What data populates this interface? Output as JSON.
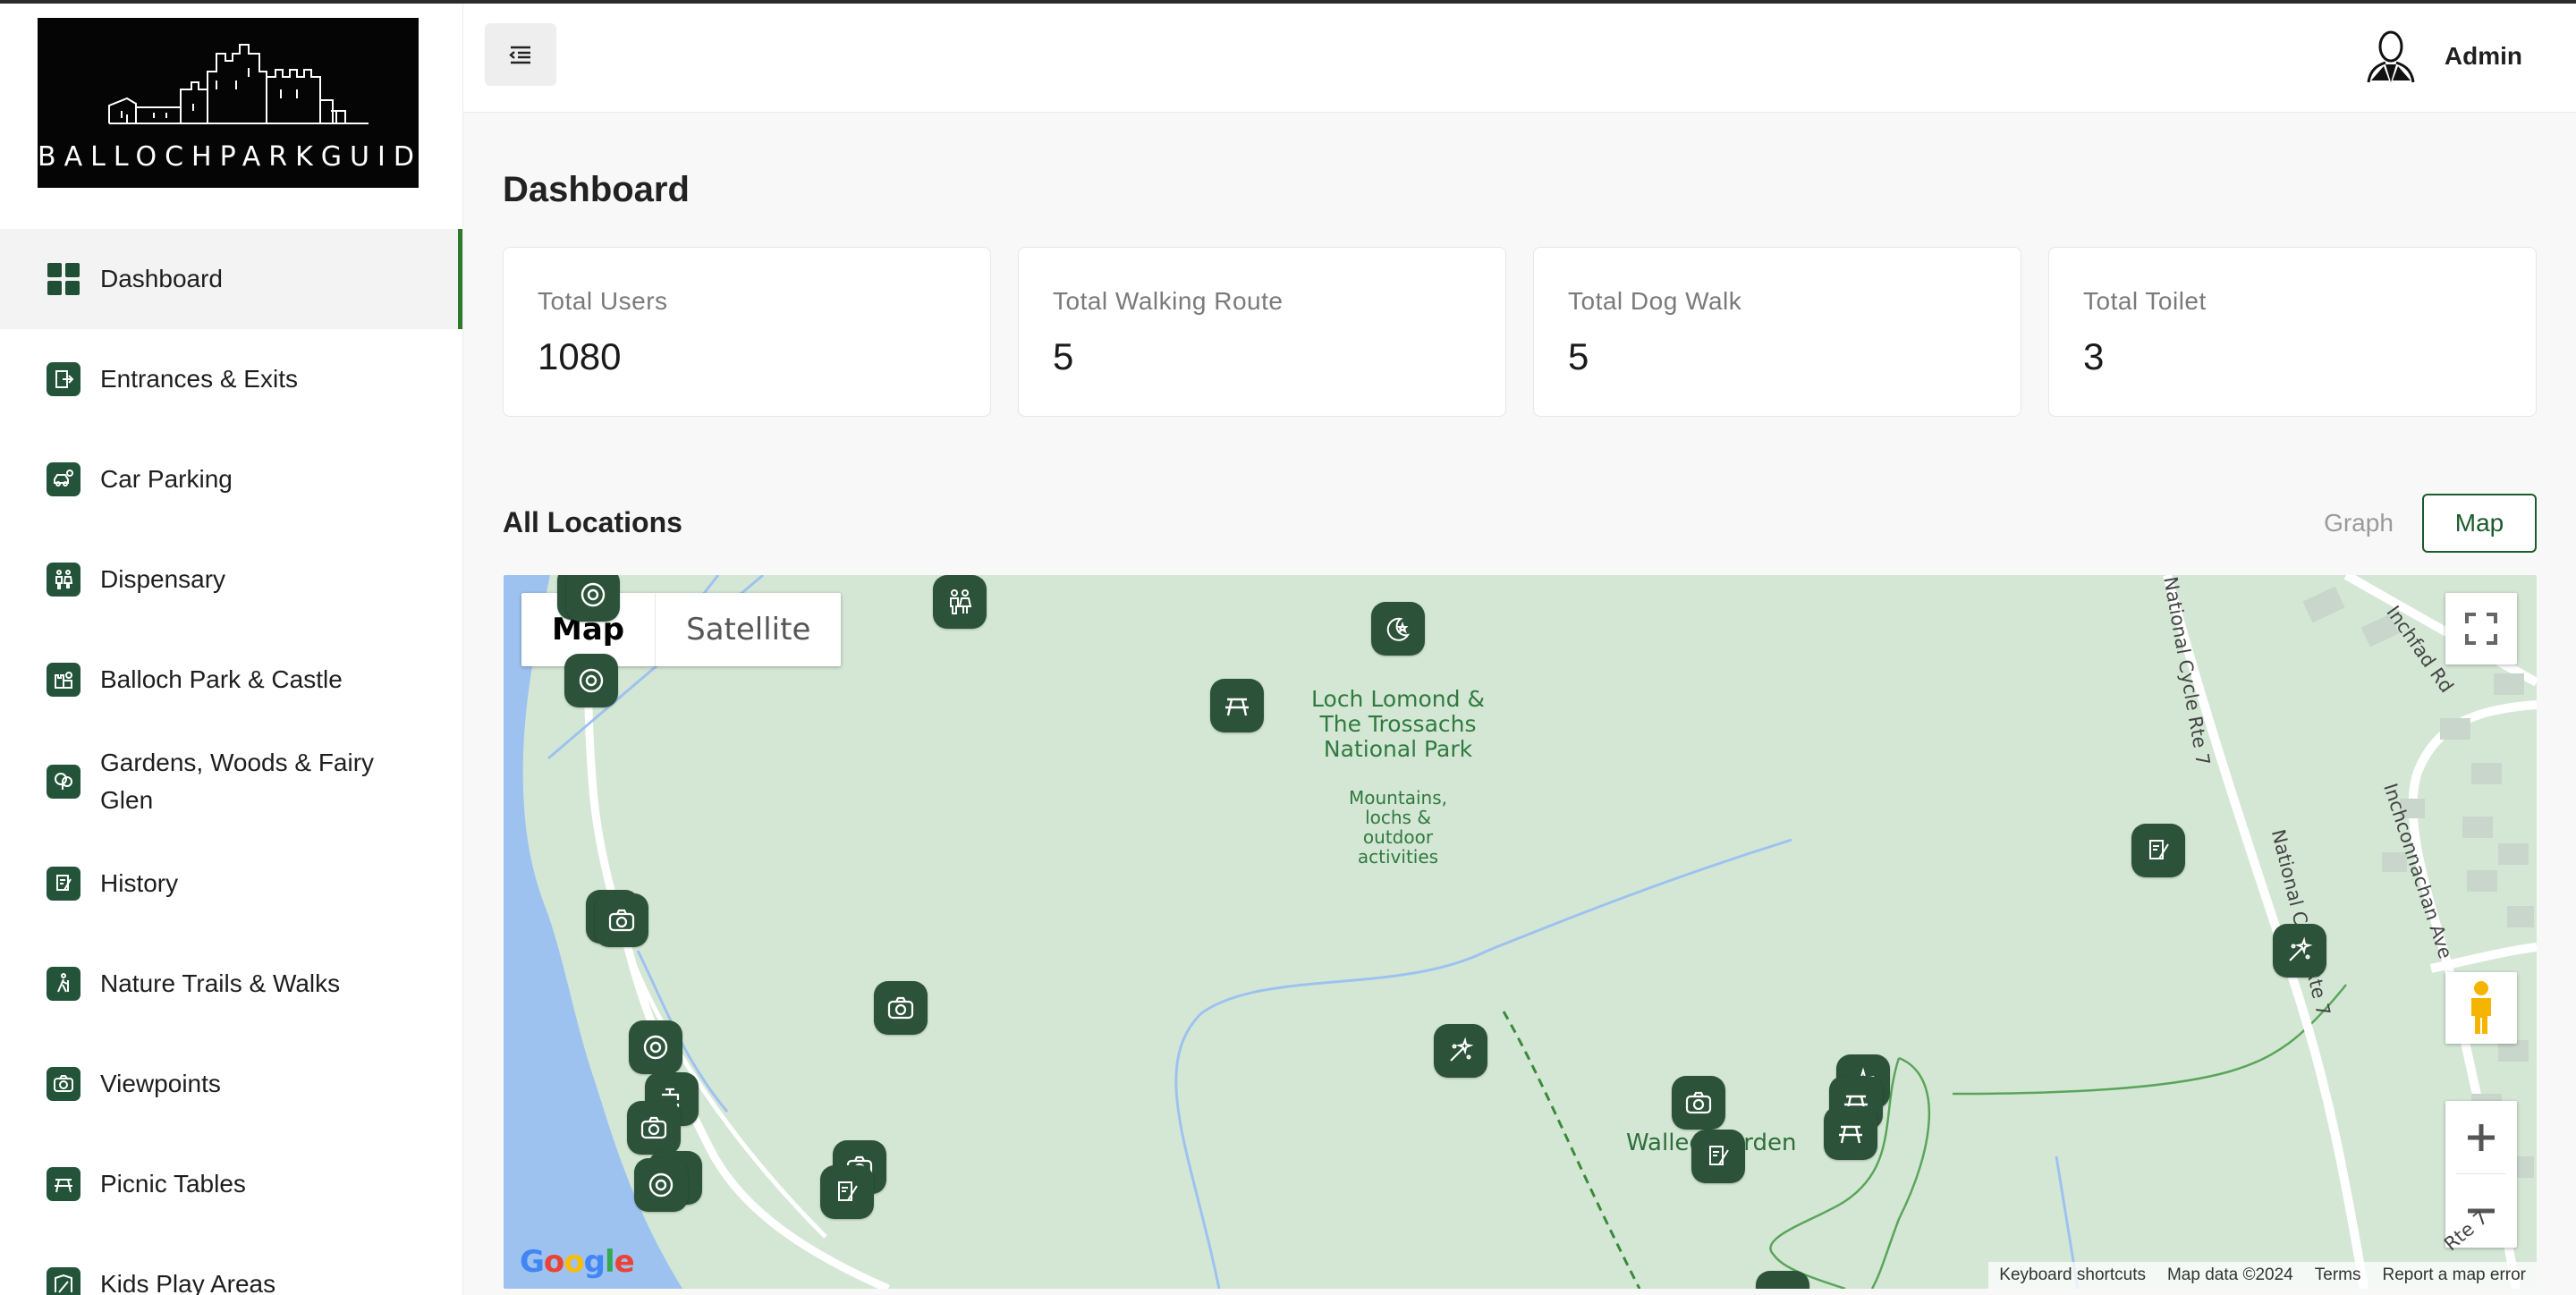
{
  "brand": {
    "logo_text": "BALLOCHPARKGUIDE"
  },
  "sidebar": {
    "items": [
      {
        "label": "Dashboard",
        "icon": "dashboard-grid-icon",
        "active": true
      },
      {
        "label": "Entrances & Exits",
        "icon": "exit-door-icon"
      },
      {
        "label": "Car Parking",
        "icon": "car-icon"
      },
      {
        "label": "Dispensary",
        "icon": "toilet-people-icon"
      },
      {
        "label": "Balloch Park & Castle",
        "icon": "castle-icon"
      },
      {
        "label": "Gardens, Woods & Fairy Glen",
        "icon": "tree-icon"
      },
      {
        "label": "History",
        "icon": "scroll-icon"
      },
      {
        "label": "Nature Trails & Walks",
        "icon": "hiker-icon"
      },
      {
        "label": "Viewpoints",
        "icon": "camera-icon"
      },
      {
        "label": "Picnic Tables",
        "icon": "picnic-table-icon"
      },
      {
        "label": "Kids Play Areas",
        "icon": "playground-icon"
      }
    ]
  },
  "header": {
    "user_name": "Admin"
  },
  "main": {
    "title": "Dashboard",
    "stats": [
      {
        "label": "Total Users",
        "value": "1080"
      },
      {
        "label": "Total Walking Route",
        "value": "5"
      },
      {
        "label": "Total Dog Walk",
        "value": "5"
      },
      {
        "label": "Total Toilet",
        "value": "3"
      }
    ],
    "locations": {
      "title": "All Locations",
      "graph_label": "Graph",
      "map_label": "Map"
    }
  },
  "map": {
    "type_map": "Map",
    "type_satellite": "Satellite",
    "park_title": "Loch Lomond & The Trossachs National Park",
    "park_subtitle": "Mountains, lochs & outdoor activities",
    "walled_garden": "Walled Garden",
    "streets": {
      "cycle_top": "National Cycle Rte 7",
      "cycle_mid": "National Cycle Rte 7",
      "cycle_bottom": "Rte 7",
      "inchfad": "Inchfad Rd",
      "inchconnachan": "Inchconnachan Ave"
    },
    "logo": "Google",
    "attribution": {
      "shortcuts": "Keyboard shortcuts",
      "data": "Map data ©2024",
      "terms": "Terms",
      "report": "Report a map error"
    },
    "colors": {
      "land": "#d4e7d5",
      "water": "#9ec2f0",
      "path": "#5aa55a",
      "marker": "#2c5239"
    },
    "markers": [
      "picnic-table-icon",
      "camera-icon",
      "lifebuoy-icon",
      "toilet-people-icon",
      "scroll-icon",
      "fairy-wand-icon",
      "night-star-icon",
      "tap-icon"
    ]
  }
}
